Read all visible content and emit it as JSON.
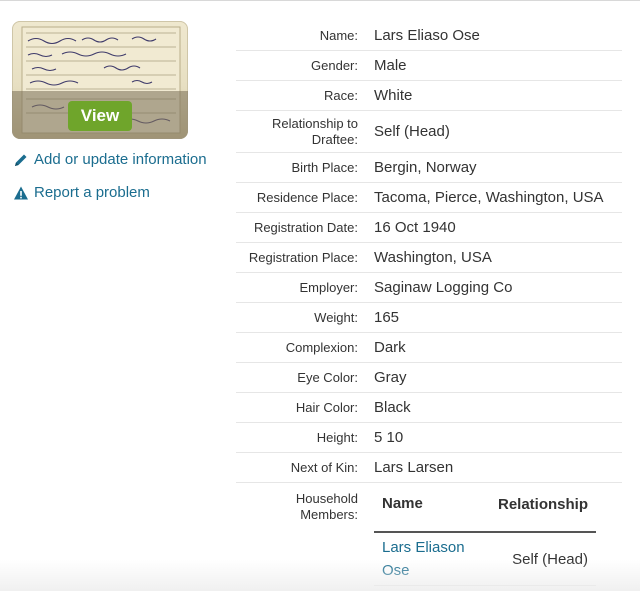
{
  "thumbnail": {
    "view_label": "View"
  },
  "links": {
    "add_update": "Add or update information",
    "report": "Report a problem"
  },
  "details": [
    {
      "label": "Name:",
      "value": "Lars Eliaso Ose"
    },
    {
      "label": "Gender:",
      "value": "Male"
    },
    {
      "label": "Race:",
      "value": "White"
    },
    {
      "label": "Relationship to Draftee:",
      "value": "Self (Head)"
    },
    {
      "label": "Birth Place:",
      "value": "Bergin, Norway"
    },
    {
      "label": "Residence Place:",
      "value": "Tacoma, Pierce, Washington, USA"
    },
    {
      "label": "Registration Date:",
      "value": "16 Oct 1940"
    },
    {
      "label": "Registration Place:",
      "value": "Washington, USA"
    },
    {
      "label": "Employer:",
      "value": "Saginaw Logging Co"
    },
    {
      "label": "Weight:",
      "value": "165"
    },
    {
      "label": "Complexion:",
      "value": "Dark"
    },
    {
      "label": "Eye Color:",
      "value": "Gray"
    },
    {
      "label": "Hair Color:",
      "value": "Black"
    },
    {
      "label": "Height:",
      "value": "5 10"
    },
    {
      "label": "Next of Kin:",
      "value": "Lars Larsen"
    }
  ],
  "household": {
    "label": "Household Members:",
    "columns": {
      "name": "Name",
      "relationship": "Relationship"
    },
    "rows": [
      {
        "name": "Lars Eliason Ose",
        "relationship": "Self (Head)"
      }
    ]
  },
  "colors": {
    "link": "#1b6d8f",
    "view_button": "#6fa52b"
  }
}
